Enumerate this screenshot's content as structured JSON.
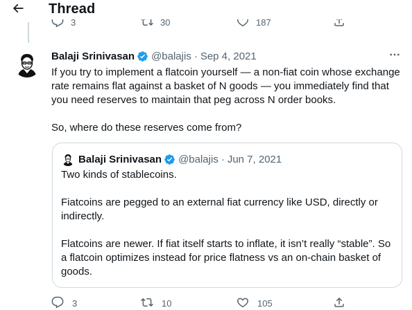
{
  "header": {
    "title": "Thread",
    "back_icon": "arrow-left-icon"
  },
  "prev_actions": {
    "replies": "3",
    "retweets": "30",
    "likes": "187"
  },
  "tweet": {
    "author_name": "Balaji Srinivasan",
    "handle": "@balajis",
    "separator": "·",
    "date": "Sep 4, 2021",
    "paragraphs": [
      "If you try to implement a flatcoin yourself — a non-fiat coin whose exchange rate remains flat against a basket of N goods — you immediately find that you need reserves to maintain that peg across N order books.",
      "So, where do these reserves come from?"
    ],
    "quoted": {
      "author_name": "Balaji Srinivasan",
      "handle": "@balajis",
      "separator": "·",
      "date": "Jun 7, 2021",
      "paragraphs": [
        "Two kinds of stablecoins.",
        "Fiatcoins are pegged to an external fiat currency like USD, directly or indirectly.",
        "Flatcoins are newer. If fiat itself starts to inflate, it isn’t really “stable”. So a flatcoin optimizes instead for price flatness vs an on-chain basket of goods."
      ]
    },
    "stats": {
      "replies": "3",
      "retweets": "10",
      "likes": "105"
    }
  },
  "colors": {
    "verified": "#1d9bf0",
    "muted": "#536471",
    "border": "#cfd9de",
    "text": "#0f1419"
  }
}
